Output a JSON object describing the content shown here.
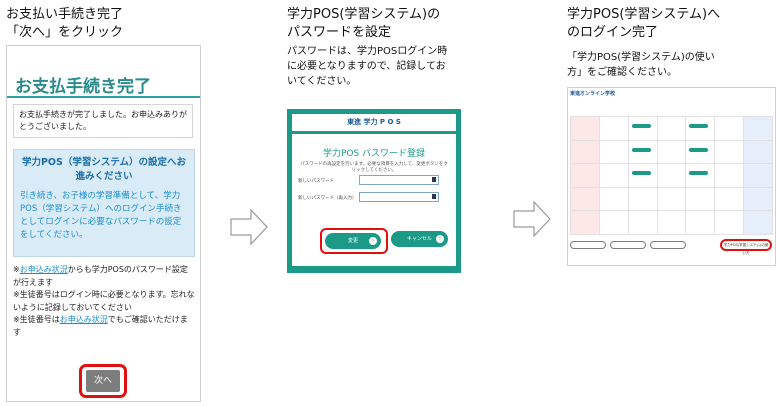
{
  "colors": {
    "accent": "#2a8a8c",
    "teal": "#1b9a87",
    "link": "#1d8fd0",
    "highlight": "#e01010"
  },
  "step1": {
    "caption": "お支払い手続き完了\n「次へ」をクリック",
    "phone_title": "お支払手続き完了",
    "message": "お支払手続きが完了しました。お申込みありがとうございました。",
    "info_title": "学力POS（学習システム）の設定へお進みください",
    "info_body": "引き続き、お子様の学習準備として、学力POS（学習システム）へのログイン手続きとしてログインに必要なパスワードの設定をしてください。",
    "note1_link": "お申込み状況",
    "note1_rest": "からも学力POSのパスワード設定が行えます",
    "note2": "※生徒番号はログイン時に必要となります。忘れないように記録しておいてください",
    "note3_pre": "※生徒番号は",
    "note3_link": "お申込み状況",
    "note3_post": "でもご確認いただけます",
    "note1_prefix": "※",
    "next_button": "次へ"
  },
  "step2": {
    "caption_title": "学力POS(学習システム)の\nパスワードを設定",
    "caption_body": "パスワードは、学力POSログイン時\nに必要となりますので、記録してお\nいてください。",
    "brand": "東進 学力 P O S",
    "card_title": "学力POS パスワード登録",
    "card_desc": "パスワードの再設定を行います。必要な項目を入力して、変更ボタンをクリックしてください。",
    "new_password_label": "新しいパスワード",
    "confirm_label": "新しいパスワード（再入力）",
    "submit_button": "変更",
    "cancel_button": "キャンセル"
  },
  "step3": {
    "caption_title": "学力POS(学習システム)へ\nのログイン完了",
    "caption_body": "「学力POS(学習システム)の使い\n方」をご確認ください。",
    "school_name": "東進オンライン学校",
    "howto_link": "学力POS(学習システム)の使い方"
  }
}
